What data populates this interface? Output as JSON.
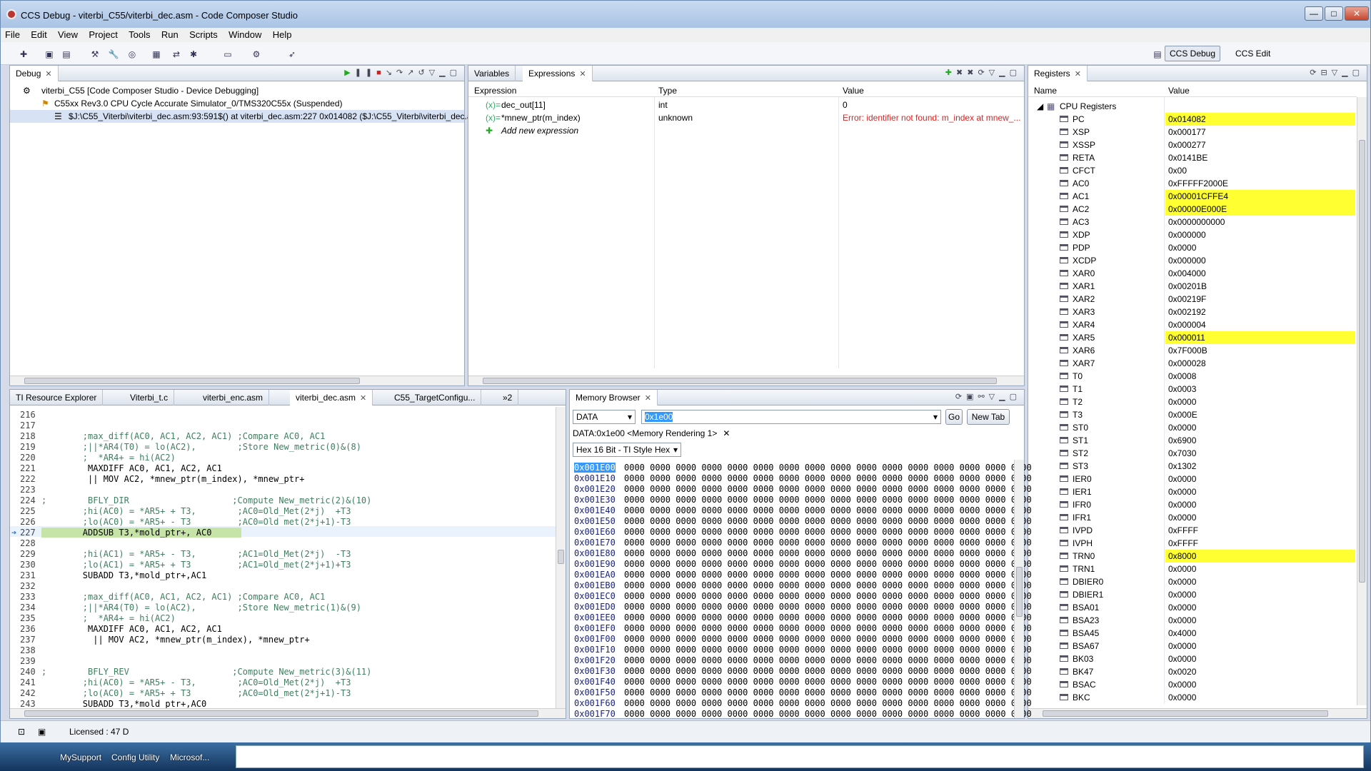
{
  "window": {
    "title": "CCS Debug - viterbi_C55/viterbi_dec.asm - Code Composer Studio",
    "minimize": "—",
    "maximize": "□",
    "close": "✕"
  },
  "menu": [
    "File",
    "Edit",
    "View",
    "Project",
    "Tools",
    "Run",
    "Scripts",
    "Window",
    "Help"
  ],
  "perspectives": {
    "debug": "CCS Debug",
    "edit": "CCS Edit"
  },
  "debug_view": {
    "tab": "Debug",
    "tree": [
      "viterbi_C55 [Code Composer Studio - Device Debugging]",
      "C55xx Rev3.0 CPU Cycle Accurate Simulator_0/TMS320C55x (Suspended)",
      "$J:\\C55_Viterbi\\viterbi_dec.asm:93:591$() at viterbi_dec.asm:227 0x014082  ($J:\\C55_Viterbi\\viterbi_dec.asr"
    ]
  },
  "expressions_view": {
    "tabs": [
      "Variables",
      "Expressions"
    ],
    "columns": [
      "Expression",
      "Type",
      "Value"
    ],
    "rows": [
      {
        "expression": "dec_out[11]",
        "type": "int",
        "value": "0"
      },
      {
        "expression": "*mnew_ptr(m_index)",
        "type": "unknown",
        "value": "Error: identifier not found: m_index at mnew_..."
      }
    ],
    "add_new": "Add new expression"
  },
  "registers_view": {
    "tab": "Registers",
    "columns": [
      "Name",
      "Value"
    ],
    "group": "CPU Registers",
    "rows": [
      {
        "name": "PC",
        "value": "0x014082"
      },
      {
        "name": "XSP",
        "value": "0x000177"
      },
      {
        "name": "XSSP",
        "value": "0x000277"
      },
      {
        "name": "RETA",
        "value": "0x0141BE"
      },
      {
        "name": "CFCT",
        "value": "0x00"
      },
      {
        "name": "AC0",
        "value": "0xFFFFF2000E"
      },
      {
        "name": "AC1",
        "value": "0x00001CFFE4"
      },
      {
        "name": "AC2",
        "value": "0x00000E000E"
      },
      {
        "name": "AC3",
        "value": "0x0000000000"
      },
      {
        "name": "XDP",
        "value": "0x000000"
      },
      {
        "name": "PDP",
        "value": "0x0000"
      },
      {
        "name": "XCDP",
        "value": "0x000000"
      },
      {
        "name": "XAR0",
        "value": "0x004000"
      },
      {
        "name": "XAR1",
        "value": "0x00201B"
      },
      {
        "name": "XAR2",
        "value": "0x00219F"
      },
      {
        "name": "XAR3",
        "value": "0x002192"
      },
      {
        "name": "XAR4",
        "value": "0x000004"
      },
      {
        "name": "XAR5",
        "value": "0x000011"
      },
      {
        "name": "XAR6",
        "value": "0x7F000B"
      },
      {
        "name": "XAR7",
        "value": "0x000028"
      },
      {
        "name": "T0",
        "value": "0x0008"
      },
      {
        "name": "T1",
        "value": "0x0003"
      },
      {
        "name": "T2",
        "value": "0x0000"
      },
      {
        "name": "T3",
        "value": "0x000E"
      },
      {
        "name": "ST0",
        "value": "0x0000"
      },
      {
        "name": "ST1",
        "value": "0x6900"
      },
      {
        "name": "ST2",
        "value": "0x7030"
      },
      {
        "name": "ST3",
        "value": "0x1302"
      },
      {
        "name": "IER0",
        "value": "0x0000"
      },
      {
        "name": "IER1",
        "value": "0x0000"
      },
      {
        "name": "IFR0",
        "value": "0x0000"
      },
      {
        "name": "IFR1",
        "value": "0x0000"
      },
      {
        "name": "IVPD",
        "value": "0xFFFF"
      },
      {
        "name": "IVPH",
        "value": "0xFFFF"
      },
      {
        "name": "TRN0",
        "value": "0x8000"
      },
      {
        "name": "TRN1",
        "value": "0x0000"
      },
      {
        "name": "DBIER0",
        "value": "0x0000"
      },
      {
        "name": "DBIER1",
        "value": "0x0000"
      },
      {
        "name": "BSA01",
        "value": "0x0000"
      },
      {
        "name": "BSA23",
        "value": "0x0000"
      },
      {
        "name": "BSA45",
        "value": "0x4000"
      },
      {
        "name": "BSA67",
        "value": "0x0000"
      },
      {
        "name": "BK03",
        "value": "0x0000"
      },
      {
        "name": "BK47",
        "value": "0x0020"
      },
      {
        "name": "BSAC",
        "value": "0x0000"
      },
      {
        "name": "BKC",
        "value": "0x0000"
      }
    ],
    "highlighted": [
      "PC",
      "AC1",
      "AC2",
      "XAR5",
      "TRN0"
    ],
    "highlight_color": "#ffff32"
  },
  "editor": {
    "tabs": [
      "TI Resource Explorer",
      "Viterbi_t.c",
      "viterbi_enc.asm",
      "viterbi_dec.asm",
      "C55_TargetConfigu...",
      "»2"
    ],
    "current_line": "227",
    "lines": [
      {
        "n": "216",
        "t": ""
      },
      {
        "n": "217",
        "t": ""
      },
      {
        "n": "218",
        "t": "        ;max_diff(AC0, AC1, AC2, AC1) ;Compare AC0, AC1"
      },
      {
        "n": "219",
        "t": "        ;||*AR4(T0) = lo(AC2),        ;Store New_metric(0)&(8)"
      },
      {
        "n": "220",
        "t": "        ;  *AR4+ = hi(AC2)"
      },
      {
        "n": "221",
        "t": "         MAXDIFF AC0, AC1, AC2, AC1"
      },
      {
        "n": "222",
        "t": "         || MOV AC2, *mnew_ptr(m_index), *mnew_ptr+"
      },
      {
        "n": "223",
        "t": ""
      },
      {
        "n": "224",
        "t": ";        BFLY_DIR                    ;Compute New_metric(2)&(10)"
      },
      {
        "n": "225",
        "t": "        ;hi(AC0) = *AR5+ + T3,        ;AC0=Old_Met(2*j)  +T3"
      },
      {
        "n": "226",
        "t": "        ;lo(AC0) = *AR5+ - T3         ;AC0=Old_met(2*j+1)-T3"
      },
      {
        "n": "227",
        "t": "        ADDSUB T3,*mold_ptr+, AC0"
      },
      {
        "n": "228",
        "t": ""
      },
      {
        "n": "229",
        "t": "        ;hi(AC1) = *AR5+ - T3,        ;AC1=Old_Met(2*j)  -T3"
      },
      {
        "n": "230",
        "t": "        ;lo(AC1) = *AR5+ + T3         ;AC1=Old_met(2*j+1)+T3"
      },
      {
        "n": "231",
        "t": "        SUBADD T3,*mold_ptr+,AC1"
      },
      {
        "n": "232",
        "t": ""
      },
      {
        "n": "233",
        "t": "        ;max_diff(AC0, AC1, AC2, AC1) ;Compare AC0, AC1"
      },
      {
        "n": "234",
        "t": "        ;||*AR4(T0) = lo(AC2),        ;Store New_metric(1)&(9)"
      },
      {
        "n": "235",
        "t": "        ;  *AR4+ = hi(AC2)"
      },
      {
        "n": "236",
        "t": "         MAXDIFF AC0, AC1, AC2, AC1"
      },
      {
        "n": "237",
        "t": "          || MOV AC2, *mnew_ptr(m_index), *mnew_ptr+"
      },
      {
        "n": "238",
        "t": ""
      },
      {
        "n": "239",
        "t": ""
      },
      {
        "n": "240",
        "t": ";        BFLY_REV                    ;Compute New_metric(3)&(11)"
      },
      {
        "n": "241",
        "t": "        ;hi(AC0) = *AR5+ - T3,        ;AC0=Old_Met(2*j)  +T3"
      },
      {
        "n": "242",
        "t": "        ;lo(AC0) = *AR5+ + T3         ;AC0=Old_met(2*j+1)-T3"
      },
      {
        "n": "243",
        "t": "        SUBADD T3,*mold ptr+,AC0"
      }
    ]
  },
  "memory_browser": {
    "tab": "Memory Browser",
    "page": "DATA",
    "address": "0x1e00",
    "go": "Go",
    "new_tab": "New Tab",
    "rendering_tab": "DATA:0x1e00 <Memory Rendering 1>",
    "format": "Hex 16 Bit - TI Style Hex",
    "rows": [
      "0x001E00",
      "0x001E10",
      "0x001E20",
      "0x001E30",
      "0x001E40",
      "0x001E50",
      "0x001E60",
      "0x001E70",
      "0x001E80",
      "0x001E90",
      "0x001EA0",
      "0x001EB0",
      "0x001EC0",
      "0x001ED0",
      "0x001EE0",
      "0x001EF0",
      "0x001F00",
      "0x001F10",
      "0x001F20",
      "0x001F30",
      "0x001F40",
      "0x001F50",
      "0x001F60",
      "0x001F70"
    ],
    "values_row": "0000 0000 0000 0000 0000 0000 0000 0000 0000 0000 0000 0000 0000 0000 0000 0000"
  },
  "status": {
    "license": "Licensed : 47 D"
  },
  "taskbar": {
    "items": [
      "MySupport",
      "Config Utility",
      "Microsof..."
    ]
  }
}
